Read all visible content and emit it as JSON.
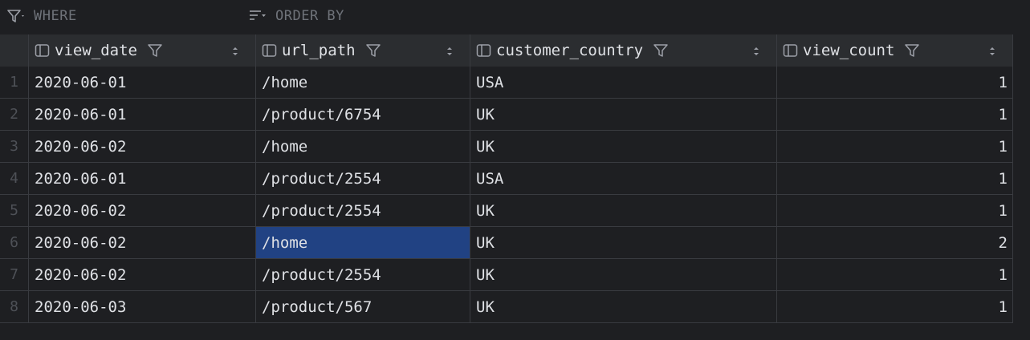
{
  "filterbar": {
    "where_label": "WHERE",
    "order_label": "ORDER BY"
  },
  "columns": [
    {
      "label": "view_date"
    },
    {
      "label": "url_path"
    },
    {
      "label": "customer_country"
    },
    {
      "label": "view_count"
    }
  ],
  "rows": [
    {
      "num": "1",
      "view_date": "2020-06-01",
      "url_path": "/home",
      "customer_country": "USA",
      "view_count": "1"
    },
    {
      "num": "2",
      "view_date": "2020-06-01",
      "url_path": "/product/6754",
      "customer_country": "UK",
      "view_count": "1"
    },
    {
      "num": "3",
      "view_date": "2020-06-02",
      "url_path": "/home",
      "customer_country": "UK",
      "view_count": "1"
    },
    {
      "num": "4",
      "view_date": "2020-06-01",
      "url_path": "/product/2554",
      "customer_country": "USA",
      "view_count": "1"
    },
    {
      "num": "5",
      "view_date": "2020-06-02",
      "url_path": "/product/2554",
      "customer_country": "UK",
      "view_count": "1"
    },
    {
      "num": "6",
      "view_date": "2020-06-02",
      "url_path": "/home",
      "customer_country": "UK",
      "view_count": "2"
    },
    {
      "num": "7",
      "view_date": "2020-06-02",
      "url_path": "/product/2554",
      "customer_country": "UK",
      "view_count": "1"
    },
    {
      "num": "8",
      "view_date": "2020-06-03",
      "url_path": "/product/567",
      "customer_country": "UK",
      "view_count": "1"
    }
  ],
  "selection": {
    "row": 6,
    "column": "url_path"
  },
  "colors": {
    "background": "#1e1f22",
    "header": "#2b2d30",
    "selected_cell": "#214283",
    "grid_line": "#393b40"
  },
  "icons": {
    "where": "filter-dropdown-icon",
    "order": "sort-lines-dropdown-icon",
    "column": "column-icon",
    "column_filter": "funnel-icon",
    "column_sort": "sort-arrows-icon"
  }
}
